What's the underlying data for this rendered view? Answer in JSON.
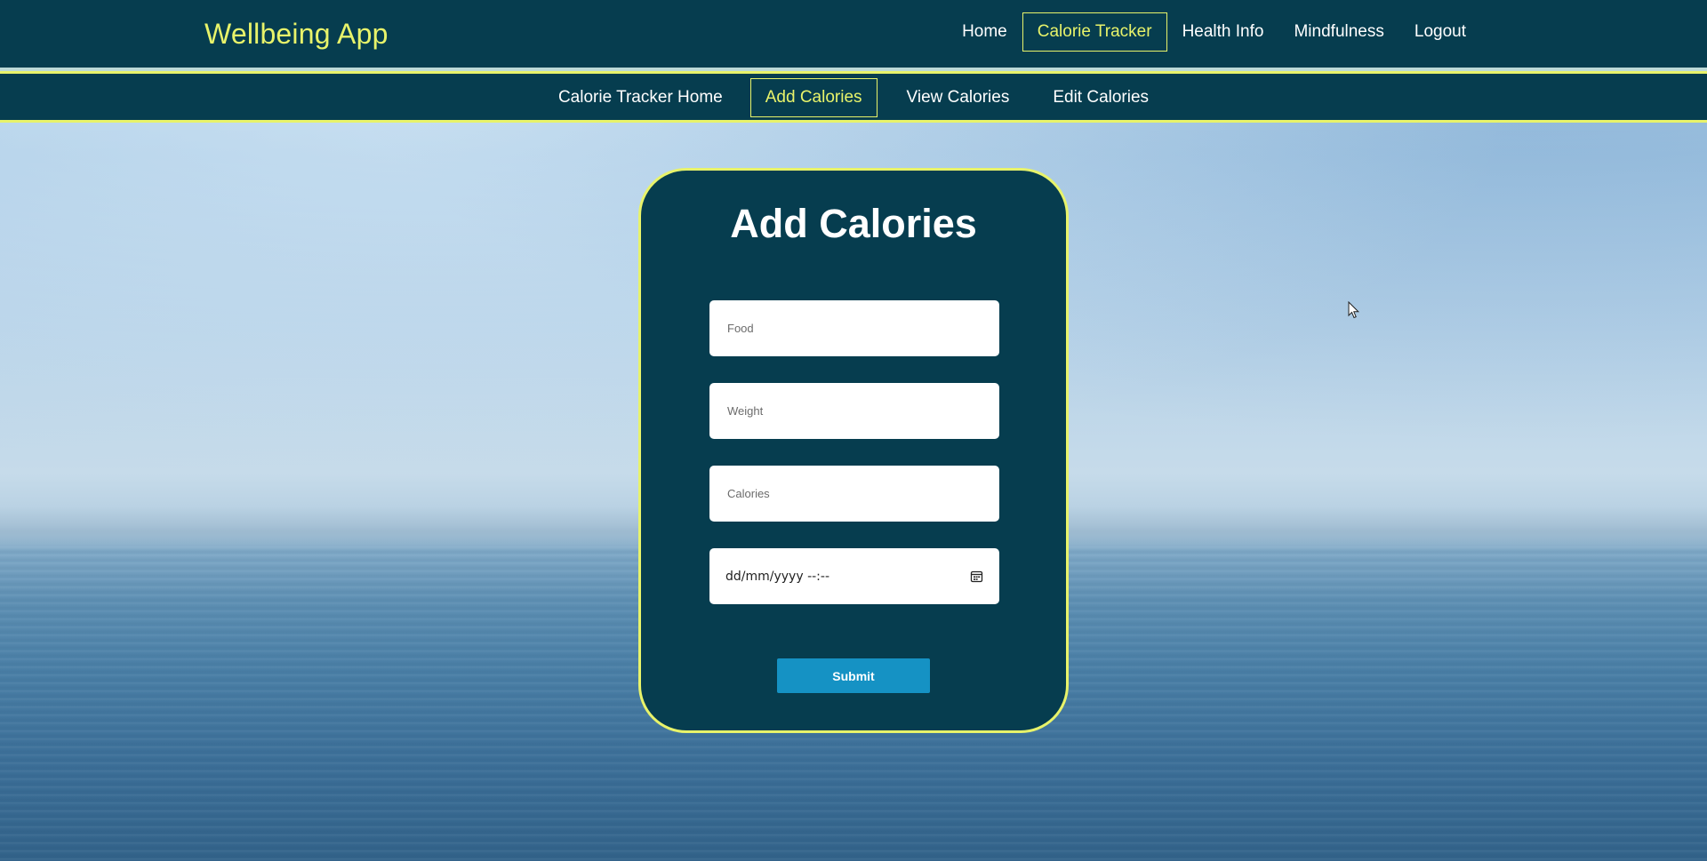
{
  "app": {
    "brand": "Wellbeing App"
  },
  "main_nav": {
    "items": [
      {
        "label": "Home",
        "active": false
      },
      {
        "label": "Calorie Tracker",
        "active": true
      },
      {
        "label": "Health Info",
        "active": false
      },
      {
        "label": "Mindfulness",
        "active": false
      },
      {
        "label": "Logout",
        "active": false
      }
    ]
  },
  "sub_nav": {
    "items": [
      {
        "label": "Calorie Tracker Home",
        "active": false
      },
      {
        "label": "Add Calories",
        "active": true
      },
      {
        "label": "View Calories",
        "active": false
      },
      {
        "label": "Edit Calories",
        "active": false
      }
    ]
  },
  "form": {
    "title": "Add Calories",
    "food_placeholder": "Food",
    "weight_placeholder": "Weight",
    "calories_placeholder": "Calories",
    "datetime_display": "dd/mm/yyyy --:--",
    "submit_label": "Submit"
  },
  "colors": {
    "nav_bg": "#063d4f",
    "accent": "#e8f36a",
    "button": "#1592c4"
  }
}
